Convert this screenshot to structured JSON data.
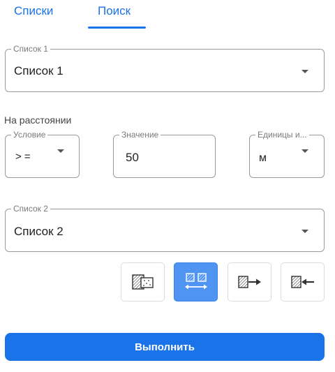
{
  "tabs": [
    {
      "label": "Списки"
    },
    {
      "label": "Поиск",
      "active": true
    }
  ],
  "list1": {
    "legend": "Список 1",
    "value": "Список 1"
  },
  "distance_label": "На расстоянии",
  "condition": {
    "legend": "Условие",
    "value": "> ="
  },
  "value_field": {
    "legend": "Значение",
    "value": "50"
  },
  "units": {
    "legend": "Единицы и...",
    "value": "м"
  },
  "list2": {
    "legend": "Список 2",
    "value": "Список 2"
  },
  "mode_buttons": [
    {
      "icon": "overlap-icon",
      "active": false
    },
    {
      "icon": "distance-icon",
      "active": true
    },
    {
      "icon": "arrow-right-icon",
      "active": false
    },
    {
      "icon": "arrow-left-icon",
      "active": false
    }
  ],
  "run_button": {
    "label": "Выполнить"
  },
  "colors": {
    "accent": "#1a73e8",
    "active_button": "#4f94f0"
  }
}
